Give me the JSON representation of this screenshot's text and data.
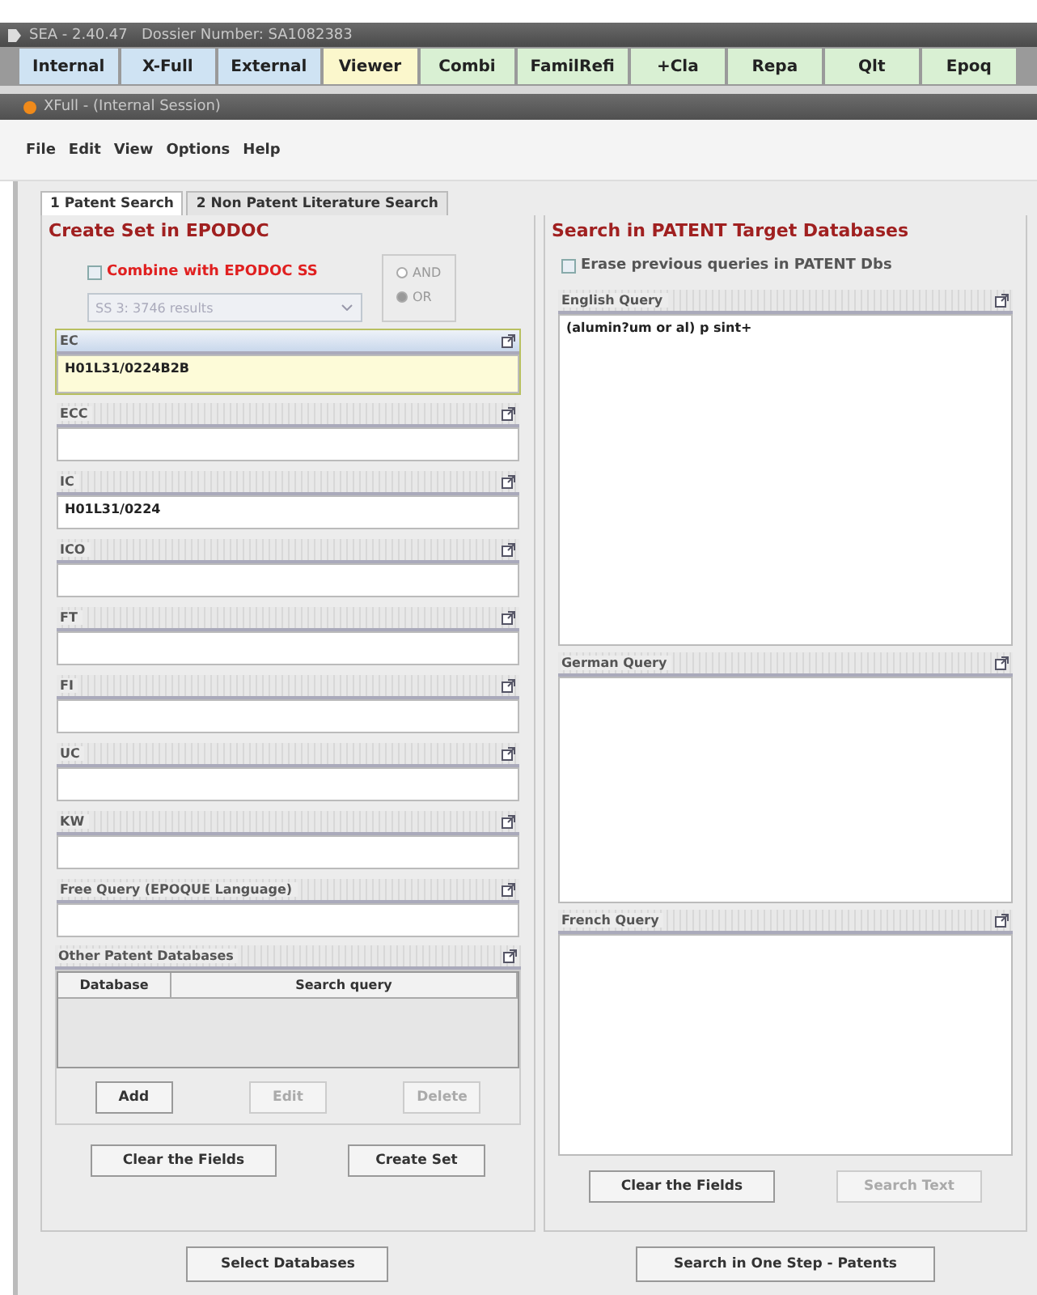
{
  "app_title": "SEA - 2.40.47   Dossier Number: SA1082383",
  "toolbar": [
    {
      "label": "Internal",
      "color": "#cfe3f3"
    },
    {
      "label": "X-Full",
      "color": "#cfe3f3"
    },
    {
      "label": "External",
      "color": "#cfe3f3"
    },
    {
      "label": "Viewer",
      "color": "#fbf7cc"
    },
    {
      "label": "Combi",
      "color": "#d9f0d3"
    },
    {
      "label": "FamilRefi",
      "color": "#d9f0d3"
    },
    {
      "label": "+Cla",
      "color": "#d9f0d3"
    },
    {
      "label": "Repa",
      "color": "#d9f0d3"
    },
    {
      "label": "Qlt",
      "color": "#d9f0d3"
    },
    {
      "label": "Epoq",
      "color": "#d9f0d3"
    }
  ],
  "window_title": "XFull - (Internal Session)",
  "menu": [
    "File",
    "Edit",
    "View",
    "Options",
    "Help"
  ],
  "tabs": [
    {
      "label": "1 Patent Search",
      "selected": true
    },
    {
      "label": "2 Non Patent Literature Search",
      "selected": false
    }
  ],
  "left_panel": {
    "title": "Create Set in EPODOC",
    "combine": {
      "label": "Combine with EPODOC SS",
      "checked": false
    },
    "set_select": {
      "value": "SS 3: 3746 results",
      "disabled": true
    },
    "operators": [
      {
        "label": "AND",
        "selected": false
      },
      {
        "label": "OR",
        "selected": true
      }
    ],
    "fields": [
      {
        "label": "EC",
        "value": "H01L31/0224B2B",
        "highlighted": true
      },
      {
        "label": "ECC",
        "highlighted": false
      },
      {
        "label": "IC",
        "value": "H01L31/0224",
        "highlighted": false
      },
      {
        "label": "ICO",
        "highlighted": false
      },
      {
        "label": "FT",
        "highlighted": false
      },
      {
        "label": "FI",
        "highlighted": false
      },
      {
        "label": "UC",
        "highlighted": false
      },
      {
        "label": "KW",
        "highlighted": false
      },
      {
        "label": "Free Query (EPOQUE Language)",
        "highlighted": false
      }
    ],
    "other_databases": {
      "title": "Other Patent Databases",
      "columns": [
        "Database",
        "Search query"
      ],
      "buttons": [
        {
          "label": "Add",
          "disabled": false
        },
        {
          "label": "Edit",
          "disabled": true
        },
        {
          "label": "Delete",
          "disabled": true
        }
      ]
    },
    "buttons": [
      {
        "label": "Clear the Fields",
        "disabled": false
      },
      {
        "label": "Create Set",
        "disabled": false
      }
    ],
    "footer_button": "Select Databases"
  },
  "right_panel": {
    "title": "Search in PATENT Target Databases",
    "erase": {
      "label": "Erase previous queries in PATENT Dbs",
      "checked": false
    },
    "queries": [
      {
        "label": "English Query",
        "value": "(alumin?um or al) p sint+"
      },
      {
        "label": "German Query"
      },
      {
        "label": "French Query"
      }
    ],
    "buttons": [
      {
        "label": "Clear the Fields",
        "disabled": false
      },
      {
        "label": "Search Text",
        "disabled": true
      }
    ],
    "footer_button": "Search in One Step - Patents"
  }
}
